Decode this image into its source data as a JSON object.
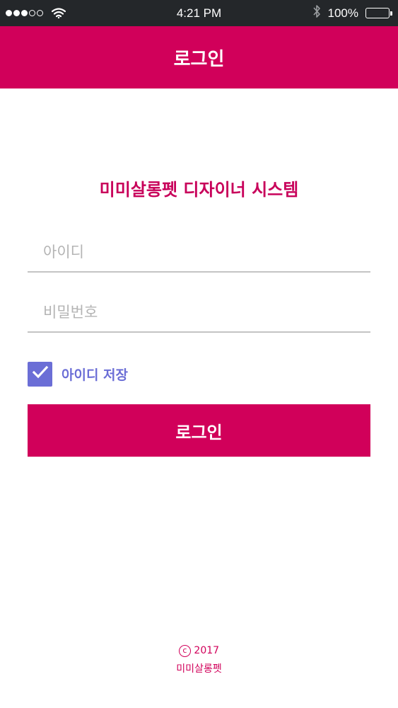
{
  "status_bar": {
    "time": "4:21 PM",
    "battery": "100%",
    "signal_bars_filled": 3,
    "signal_bars_total": 5
  },
  "header": {
    "title": "로그인"
  },
  "system_title": "미미살롱펫 디자이너 시스템",
  "form": {
    "id_placeholder": "아이디",
    "password_placeholder": "비밀번호",
    "remember_label": "아이디 저장",
    "remember_checked": true,
    "login_button_label": "로그인"
  },
  "footer": {
    "copyright_symbol": "c",
    "year": "2017",
    "brand": "미미살롱펫"
  },
  "colors": {
    "brand": "#d1005a",
    "checkbox": "#6b6ed6",
    "status_bar": "#24272a"
  },
  "icons": [
    "wifi-icon",
    "bluetooth-icon",
    "battery-icon",
    "check-icon",
    "copyright-icon"
  ]
}
